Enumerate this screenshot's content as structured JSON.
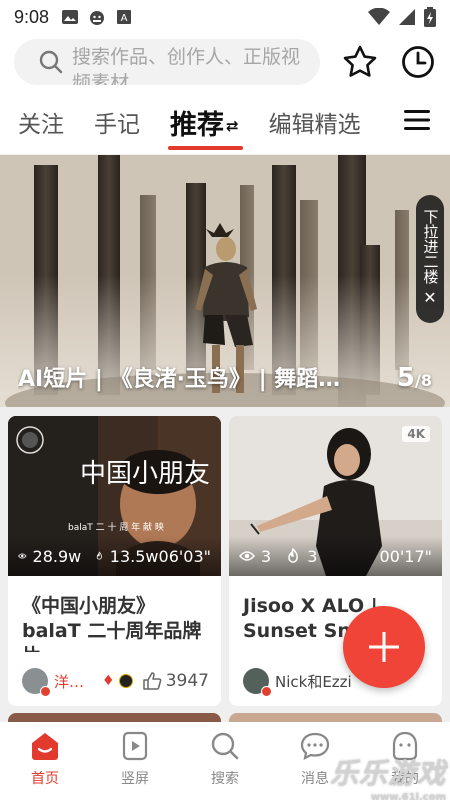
{
  "status_bar": {
    "time": "9:08",
    "left_icons": [
      "image-icon",
      "android-face-icon",
      "text-box-icon"
    ],
    "right_icons": [
      "wifi-icon",
      "signal-icon",
      "battery-icon"
    ]
  },
  "search": {
    "placeholder": "搜索作品、创作人、正版视频素材"
  },
  "top_icons": [
    "star-icon",
    "clock-icon"
  ],
  "tabs": [
    {
      "label": "关注",
      "active": false
    },
    {
      "label": "手记",
      "active": false
    },
    {
      "label": "推荐",
      "active": true
    },
    {
      "label": "编辑精选",
      "active": false
    }
  ],
  "banner": {
    "caption": "AI短片 | 《良渚·玉鸟》 | 舞蹈短片",
    "page_current": "5",
    "page_total": "/8",
    "pulldown_text": "下拉进二楼",
    "pulldown_close": "✕"
  },
  "cards": [
    {
      "title": "《中国小朋友》balaT 二十周年品牌片",
      "views": "28.9w",
      "hot": "13.5w",
      "duration": "06'03\"",
      "thumb_text": "中国小朋友",
      "thumb_subtext": "balaT 二 十 周 年 献 映",
      "author": "洋…",
      "likes": "3947"
    },
    {
      "title": "Jisoo X ALO | Sunset Sneak",
      "views": "3",
      "hot": "3",
      "duration": "00'17\"",
      "badge": "4K",
      "author": "Nick和Ezzi",
      "likes": ""
    }
  ],
  "fab": {
    "icon": "plus-icon"
  },
  "bottom_nav": [
    {
      "label": "首页",
      "icon": "home-icon",
      "active": true
    },
    {
      "label": "竖屏",
      "icon": "play-icon",
      "active": false
    },
    {
      "label": "搜索",
      "icon": "search-icon",
      "active": false
    },
    {
      "label": "消息",
      "icon": "message-icon",
      "active": false
    },
    {
      "label": "我的",
      "icon": "profile-icon",
      "active": false
    }
  ],
  "watermark": {
    "text": "乐乐游戏",
    "sub": "www.61l.com"
  },
  "colors": {
    "accent": "#e23b2e",
    "fab": "#ef4437"
  }
}
